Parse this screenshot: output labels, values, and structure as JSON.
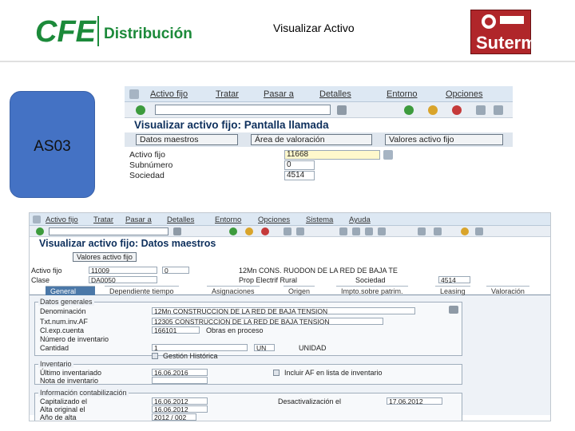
{
  "slide": {
    "title": "Visualizar Activo",
    "code": "AS03",
    "logo_left": "CFE Distribución",
    "logo_right": "Suterm"
  },
  "sap1": {
    "menu": [
      "Activo fijo",
      "Tratar",
      "Pasar a",
      "Detalles",
      "Entorno",
      "Opciones"
    ],
    "title": "Visualizar activo fijo: Pantalla llamada",
    "buttons": [
      "Datos maestros",
      "Área de valoración",
      "Valores activo fijo"
    ],
    "fields": [
      {
        "label": "Activo fijo",
        "value": "11668"
      },
      {
        "label": "Subnúmero",
        "value": "0"
      },
      {
        "label": "Sociedad",
        "value": "4514"
      }
    ]
  },
  "sap2": {
    "menu": [
      "Activo fijo",
      "Tratar",
      "Pasar a",
      "Detalles",
      "Entorno",
      "Opciones",
      "Sistema",
      "Ayuda"
    ],
    "title": "Visualizar activo fijo: Datos maestros",
    "button": "Valores activo fijo",
    "header": {
      "activo_label": "Activo fijo",
      "activo_value": "11009",
      "sub_value": "0",
      "desc_value": "12Mn CONS. RUODON DE LA RED DE BAJA TE",
      "clase_label": "Clase",
      "clase_value": "DA0050",
      "clase_desc": "Prop Electrif Rural",
      "sociedad_label": "Sociedad",
      "sociedad_value": "4514"
    },
    "tabs": [
      "General",
      "Dependiente tiempo",
      "Asignaciones",
      "Origen",
      "Impto.sobre patrim.",
      "Leasing",
      "Valoración"
    ],
    "general": {
      "group_label": "Datos generales",
      "denominacion_label": "Denominación",
      "denominacion_value": "12Mn CONSTRUCCION DE LA RED DE BAJA TENSION",
      "texto_label": "Txt.num.inv.AF",
      "texto_value": "12305 CONSTRUCCION DE LA RED DE BAJA TENSION",
      "cuenta_label": "Cl.exp.cuenta",
      "cuenta_value": "166101",
      "cuenta_desc": "Obras en proceso",
      "serie_label": "Número de inventario",
      "cantidad_label": "Cantidad",
      "cantidad_value": "1",
      "unidad_value": "UN",
      "unidad_desc": "UNIDAD",
      "gestion_label": "Gestión Histórica"
    },
    "inventario": {
      "group_label": "Inventario",
      "fecha_label": "Último inventariado",
      "fecha_value": "16.06.2016",
      "nota_label": "Nota de inventario",
      "incluir_label": "Incluir AF en lista de inventario"
    },
    "contab": {
      "group_label": "Información contabilización",
      "capit_label": "Capitalizado el",
      "capit_value": "16.06.2012",
      "alta_label": "Alta original el",
      "alta_value": "16.06.2012",
      "anio_label": "Año de alta",
      "anio_value": "2012 / 002",
      "desact_label": "Desactivalización el",
      "desact_value": "17.06.2012"
    }
  }
}
